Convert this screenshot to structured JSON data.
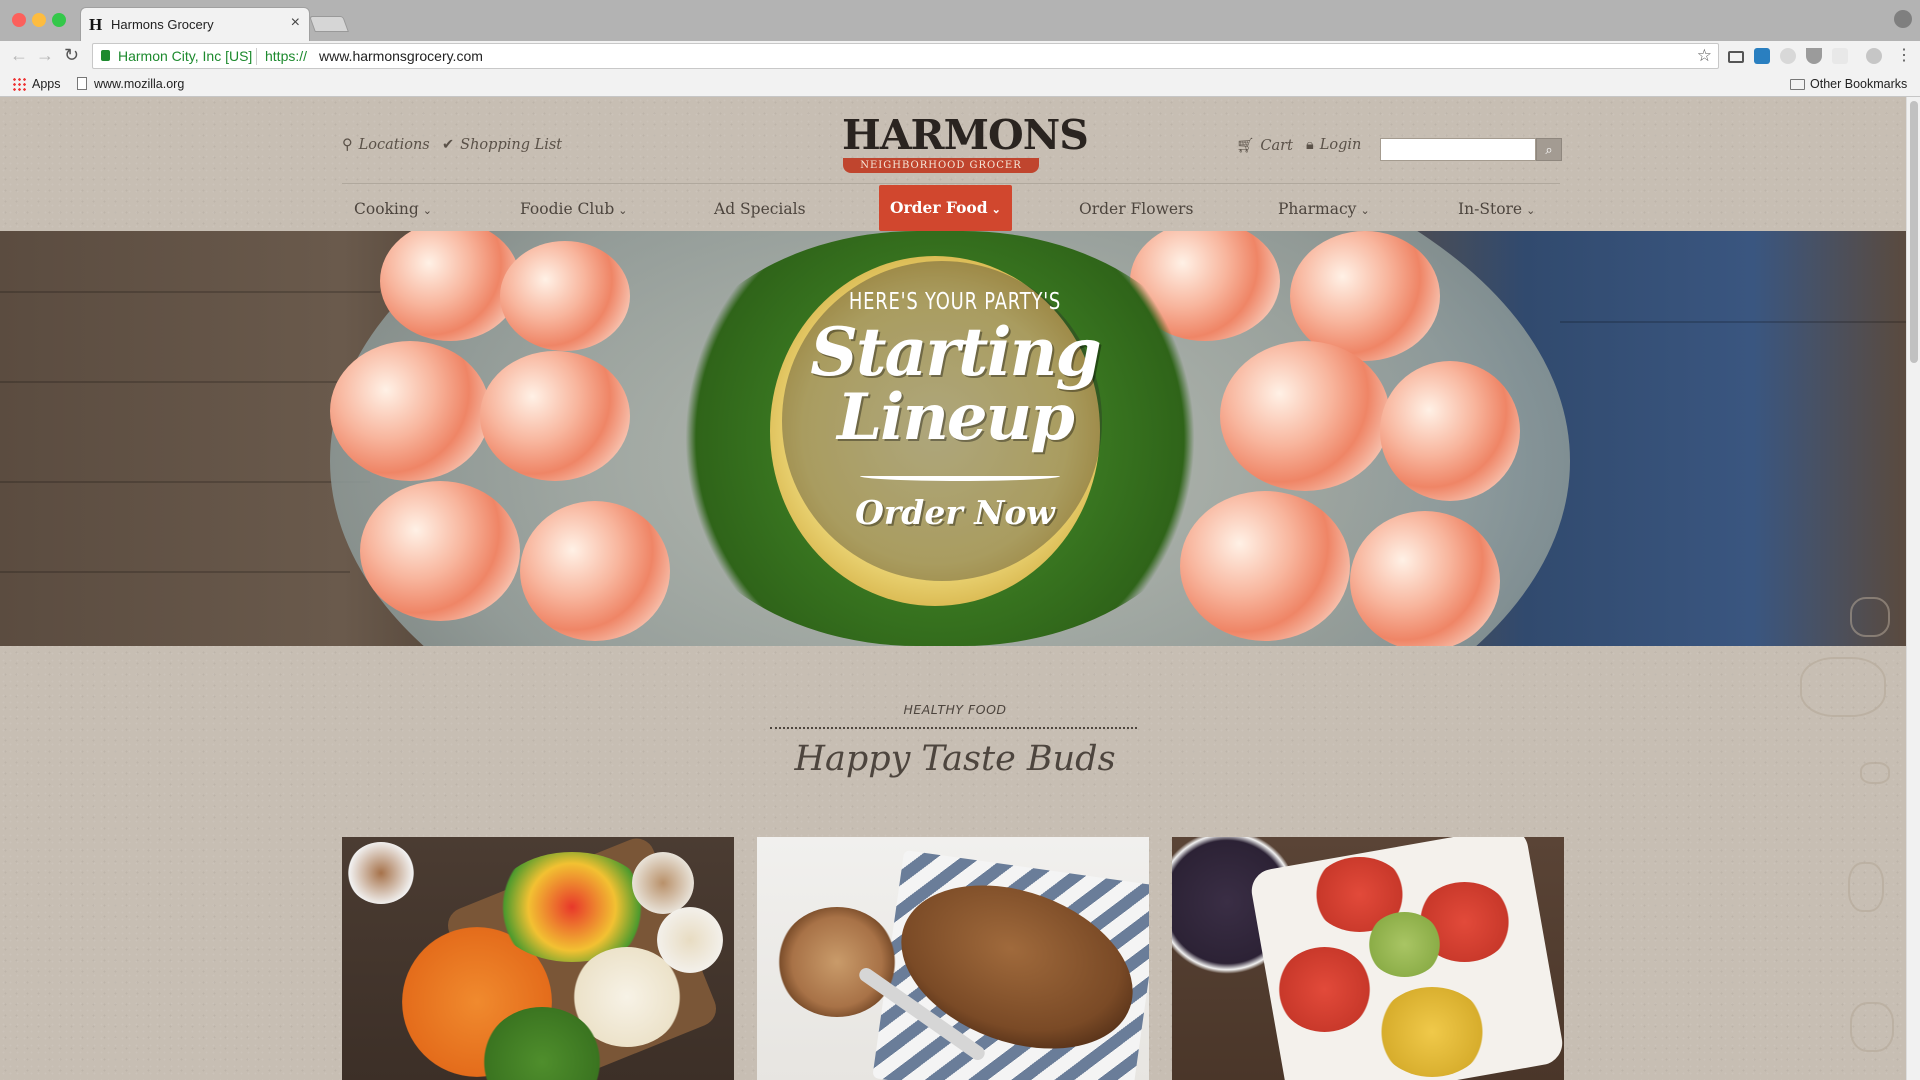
{
  "browser": {
    "tab_title": "Harmons Grocery",
    "tab_favicon": "H",
    "tab_close": "×",
    "identity": "Harmon City, Inc [US]",
    "url_scheme": "https://",
    "url_host": "www.harmonsgrocery.com",
    "bookmarks": {
      "apps_label": "Apps",
      "item1": "www.mozilla.org",
      "other": "Other Bookmarks"
    },
    "icons": [
      "back-icon",
      "forward-icon",
      "reload-icon",
      "lock-icon",
      "star-icon",
      "profile-icon"
    ],
    "traffic_colors": [
      "#fc605c",
      "#fdbc40",
      "#34c84a"
    ]
  },
  "header": {
    "logo_word": "HARMONS",
    "logo_tag": "NEIGHBORHOOD GROCER",
    "locations": "Locations",
    "shopping_list": "Shopping List",
    "cart": "Cart",
    "login": "Login",
    "search_value": ""
  },
  "nav": {
    "items": [
      {
        "label": "Cooking",
        "dropdown": true
      },
      {
        "label": "Foodie Club",
        "dropdown": true
      },
      {
        "label": "Ad Specials",
        "dropdown": false
      },
      {
        "label": "Order Food",
        "dropdown": true,
        "active": true
      },
      {
        "label": "Order Flowers",
        "dropdown": false
      },
      {
        "label": "Pharmacy",
        "dropdown": true
      },
      {
        "label": "In-Store",
        "dropdown": true
      }
    ],
    "accent": "#d1472e"
  },
  "hero": {
    "line1": "HERE'S YOUR PARTY'S",
    "line2": "Starting",
    "line3": "Lineup",
    "cta": "Order Now"
  },
  "section": {
    "kicker": "HEALTHY FOOD",
    "title": "Happy Taste Buds"
  }
}
